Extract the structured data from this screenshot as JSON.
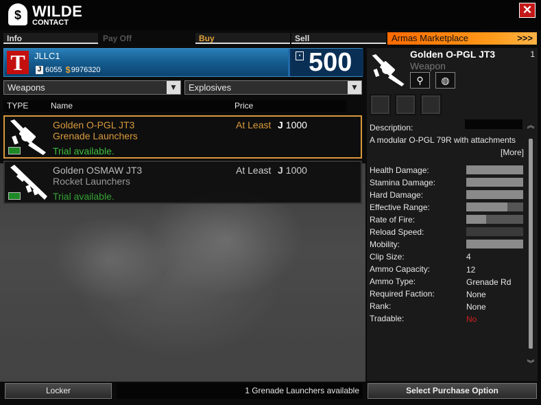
{
  "contact": {
    "name": "WILDE",
    "subtitle": "CONTACT"
  },
  "tabs": [
    {
      "label": "Info"
    },
    {
      "label": "Pay Off"
    },
    {
      "label": "Buy"
    },
    {
      "label": "Sell"
    }
  ],
  "marketplace": {
    "label": "Armas Marketplace",
    "arrows": ">>>"
  },
  "account": {
    "name": "JLLC1",
    "jcoins": "6055",
    "cash": "9976320",
    "points": "500"
  },
  "filters": {
    "category": "Weapons",
    "subcategory": "Explosives"
  },
  "list_headers": {
    "type": "TYPE",
    "name": "Name",
    "price": "Price"
  },
  "items": [
    {
      "name": "Golden O-PGL JT3",
      "category": "Grenade Launchers",
      "trial": "Trial available.",
      "price_label": "At Least",
      "price": "1000"
    },
    {
      "name": "Golden OSMAW JT3",
      "category": "Rocket Launchers",
      "trial": "Trial available.",
      "price_label": "At Least",
      "price": "1000"
    }
  ],
  "bottom": {
    "locker_label": "Locker",
    "availability": "1 Grenade Launchers available",
    "select_label": "Select Purchase Option"
  },
  "detail": {
    "title": "Golden O-PGL JT3",
    "count": "1",
    "type": "Weapon",
    "description_label": "Description:",
    "description": "A modular O-PGL 79R with attachments",
    "more_label": "[More]",
    "bar_stats": [
      {
        "label": "Health Damage:",
        "level": 1.0
      },
      {
        "label": "Stamina Damage:",
        "level": 1.0
      },
      {
        "label": "Hard Damage:",
        "level": 1.0
      },
      {
        "label": "Effective Range:",
        "level": 0.72
      },
      {
        "label": "Rate of Fire:",
        "level": 0.35
      },
      {
        "label": "Reload Speed:",
        "level": 0.0
      },
      {
        "label": "Mobility:",
        "level": 1.0
      }
    ],
    "text_stats": [
      {
        "label": "Clip Size:",
        "value": "4"
      },
      {
        "label": "Ammo Capacity:",
        "value": "12"
      },
      {
        "label": "Ammo Type:",
        "value": "Grenade Rd"
      },
      {
        "label": "Required Faction:",
        "value": "None"
      },
      {
        "label": "Rank:",
        "value": "None"
      },
      {
        "label": "Tradable:",
        "value": "No"
      }
    ]
  },
  "colors": {
    "accent_orange": "#d99a3c",
    "trial_green": "#3fbf3f",
    "close_red": "#c41818",
    "tradable_no": "#d42020"
  }
}
